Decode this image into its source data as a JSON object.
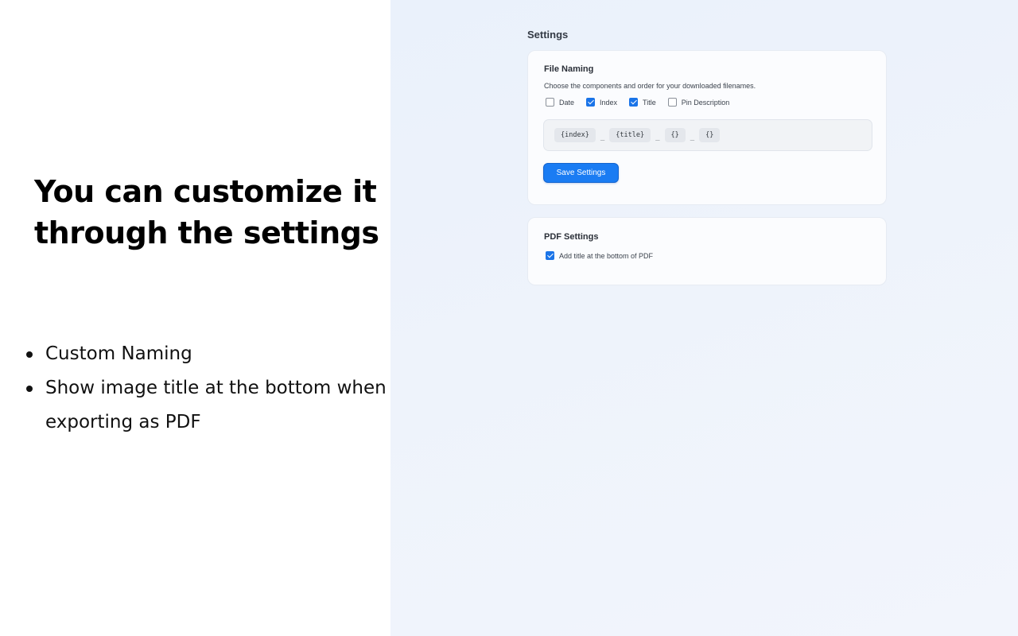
{
  "left": {
    "headline": "You can customize it through the settings",
    "features": [
      "Custom Naming",
      "Show image title at the bottom when exporting as PDF"
    ]
  },
  "settings": {
    "title": "Settings",
    "file_naming": {
      "title": "File Naming",
      "description": "Choose the components and order for your downloaded filenames.",
      "options": [
        {
          "label": "Date",
          "checked": false
        },
        {
          "label": "Index",
          "checked": true
        },
        {
          "label": "Title",
          "checked": true
        },
        {
          "label": "Pin Description",
          "checked": false
        }
      ],
      "tokens": [
        "{index}",
        "{title}",
        "{}",
        "{}"
      ],
      "separator": "_",
      "save_label": "Save Settings"
    },
    "pdf_settings": {
      "title": "PDF Settings",
      "option_label": "Add title at the bottom of PDF",
      "option_checked": true
    }
  },
  "colors": {
    "accent": "#1a7cf3",
    "checkbox_checked": "#1a74e8",
    "right_background": "#eef3fb"
  }
}
